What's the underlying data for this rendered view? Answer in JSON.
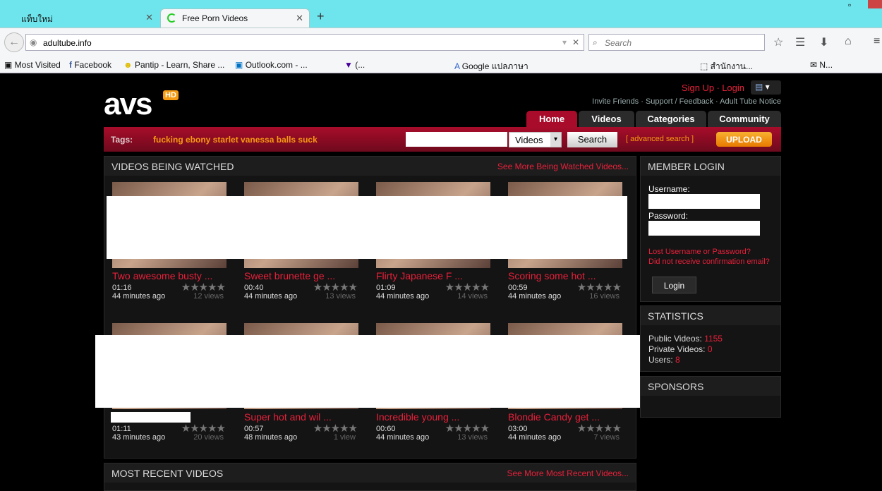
{
  "browser": {
    "tabs": [
      {
        "label": "แท็บใหม่"
      },
      {
        "label": "Free Porn Videos"
      }
    ],
    "url": "adultube.info",
    "search_placeholder": "Search",
    "bookmarks": [
      "Most Visited",
      "Facebook",
      "Pantip - Learn, Share ...",
      "Outlook.com - ...",
      "(...",
      "Google แปลภาษา",
      "สำนักงาน...",
      "N..."
    ]
  },
  "site": {
    "logo": "avs",
    "logo_badge": "HD",
    "signup": "Sign Up",
    "login": "Login",
    "sep": "·",
    "links": [
      "Invite Friends",
      "Support / Feedback",
      "Adult Tube Notice"
    ],
    "nav": [
      "Home",
      "Videos",
      "Categories",
      "Community"
    ],
    "tags_label": "Tags:",
    "tags": "fucking ebony starlet vanessa balls suck",
    "search_type": "Videos",
    "search_button": "Search",
    "advanced_search": "[ advanced search ]",
    "upload": "UPLOAD"
  },
  "watched": {
    "title": "VIDEOS BEING WATCHED",
    "more": "See More Being Watched Videos...",
    "videos": [
      {
        "title": "Two awesome busty ...",
        "duration": "01:16",
        "ago": "44 minutes ago",
        "views": "12 views"
      },
      {
        "title": "Sweet brunette ge ...",
        "duration": "00:40",
        "ago": "44 minutes ago",
        "views": "13 views"
      },
      {
        "title": "Flirty Japanese F ...",
        "duration": "01:09",
        "ago": "44 minutes ago",
        "views": "14 views"
      },
      {
        "title": "Scoring some hot ...",
        "duration": "00:59",
        "ago": "44 minutes ago",
        "views": "16 views"
      },
      {
        "title": "..",
        "duration": "01:11",
        "ago": "43 minutes ago",
        "views": "20 views"
      },
      {
        "title": "Super hot and wil ...",
        "duration": "00:57",
        "ago": "48 minutes ago",
        "views": "1 view"
      },
      {
        "title": "Incredible young ...",
        "duration": "00:60",
        "ago": "44 minutes ago",
        "views": "13 views"
      },
      {
        "title": "Blondie Candy get ...",
        "duration": "03:00",
        "ago": "44 minutes ago",
        "views": "7 views"
      }
    ]
  },
  "recent": {
    "title": "MOST RECENT VIDEOS",
    "more": "See More Most Recent Videos..."
  },
  "login": {
    "title": "MEMBER LOGIN",
    "username": "Username:",
    "password": "Password:",
    "lost": "Lost Username or Password?",
    "confirm": "Did not receive confirmation email?",
    "button": "Login"
  },
  "stats": {
    "title": "STATISTICS",
    "public_label": "Public Videos:",
    "public": "1155",
    "private_label": "Private Videos:",
    "private": "0",
    "users_label": "Users:",
    "users": "8"
  },
  "sponsors": {
    "title": "SPONSORS"
  },
  "stars": "★★★★★"
}
